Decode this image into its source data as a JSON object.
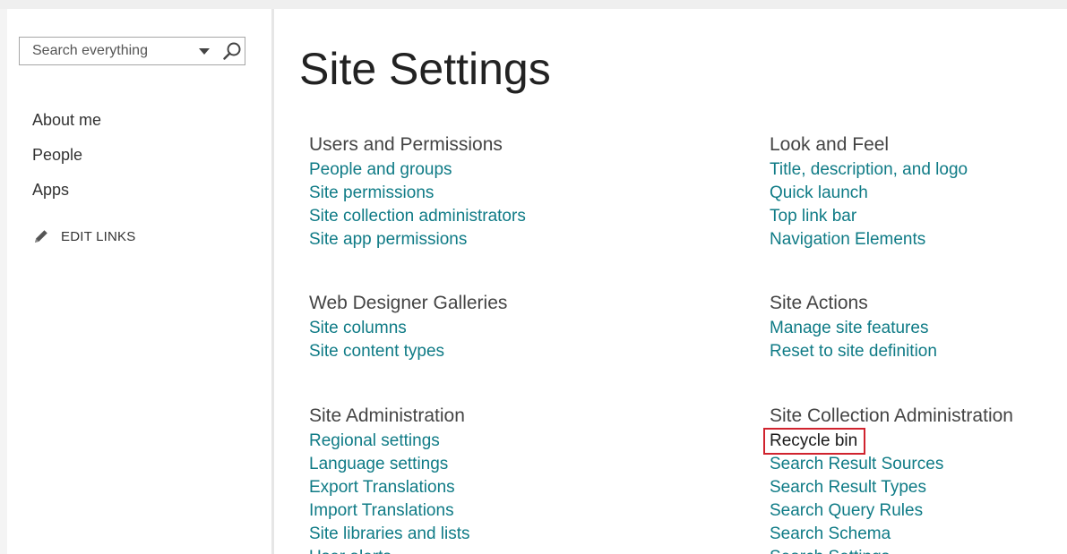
{
  "search": {
    "placeholder": "Search everything"
  },
  "nav": {
    "items": [
      "About me",
      "People",
      "Apps"
    ],
    "edit_links_label": "EDIT LINKS"
  },
  "main": {
    "page_title": "Site Settings",
    "sections": [
      {
        "heading": "Users and Permissions",
        "links": [
          "People and groups",
          "Site permissions",
          "Site collection administrators",
          "Site app permissions"
        ]
      },
      {
        "heading": "Look and Feel",
        "links": [
          "Title, description, and logo",
          "Quick launch",
          "Top link bar",
          "Navigation Elements"
        ]
      },
      {
        "heading": "Web Designer Galleries",
        "links": [
          "Site columns",
          "Site content types"
        ]
      },
      {
        "heading": "Site Actions",
        "links": [
          "Manage site features",
          "Reset to site definition"
        ]
      },
      {
        "heading": "Site Administration",
        "links": [
          "Regional settings",
          "Language settings",
          "Export Translations",
          "Import Translations",
          "Site libraries and lists",
          "User alerts"
        ]
      },
      {
        "heading": "Site Collection Administration",
        "links": [
          "Recycle bin",
          "Search Result Sources",
          "Search Result Types",
          "Search Query Rules",
          "Search Schema",
          "Search Settings"
        ]
      }
    ]
  },
  "colors": {
    "link": "#0f7b86",
    "highlight_border": "#d0232e"
  },
  "icons": {
    "search": "search-icon",
    "dropdown": "chevron-down-icon",
    "edit": "pencil-icon"
  }
}
